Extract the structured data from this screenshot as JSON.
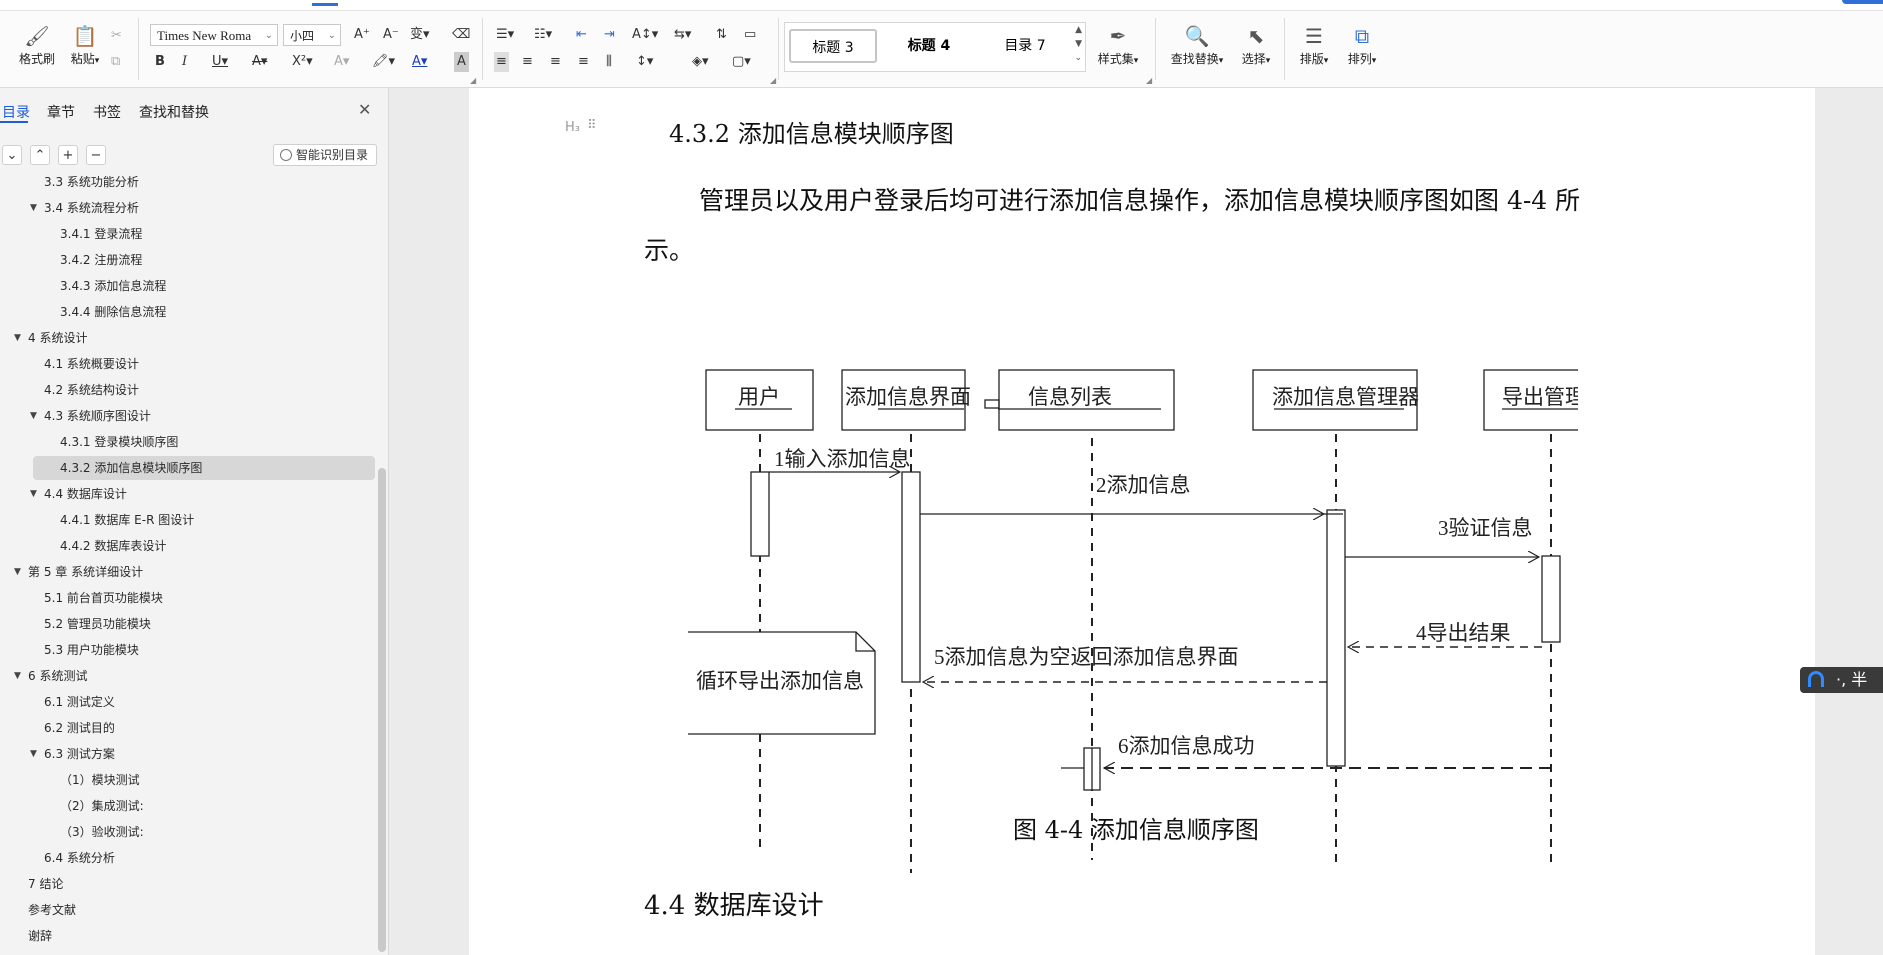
{
  "ribbon": {
    "format_painter": "格式刷",
    "paste": "粘贴",
    "font_name": "Times New Roma",
    "font_size": "小四",
    "style_gallery": [
      "标题 3",
      "标题 4",
      "目录 7"
    ],
    "style_set": "样式集",
    "find_replace": "查找替换",
    "select": "选择",
    "layout": "排版",
    "arrange": "排列"
  },
  "nav": {
    "tabs": [
      "目录",
      "章节",
      "书签",
      "查找和替换"
    ],
    "ai_toc": "智能识别目录",
    "toc": [
      {
        "label": "3.3 系统功能分析",
        "level": 2
      },
      {
        "label": "3.4 系统流程分析",
        "level": 2,
        "expanded": true
      },
      {
        "label": "3.4.1 登录流程",
        "level": 3
      },
      {
        "label": "3.4.2 注册流程",
        "level": 3
      },
      {
        "label": "3.4.3 添加信息流程",
        "level": 3
      },
      {
        "label": "3.4.4 删除信息流程",
        "level": 3
      },
      {
        "label": "4 系统设计",
        "level": 1,
        "expanded": true
      },
      {
        "label": "4.1 系统概要设计",
        "level": 2
      },
      {
        "label": "4.2 系统结构设计",
        "level": 2
      },
      {
        "label": "4.3 系统顺序图设计",
        "level": 2,
        "expanded": true
      },
      {
        "label": "4.3.1 登录模块顺序图",
        "level": 3
      },
      {
        "label": "4.3.2 添加信息模块顺序图",
        "level": 3,
        "selected": true
      },
      {
        "label": "4.4 数据库设计",
        "level": 2,
        "expanded": true
      },
      {
        "label": "4.4.1 数据库 E-R 图设计",
        "level": 3
      },
      {
        "label": "4.4.2 数据库表设计",
        "level": 3
      },
      {
        "label": "第 5 章 系统详细设计",
        "level": 1,
        "expanded": true
      },
      {
        "label": "5.1 前台首页功能模块",
        "level": 2
      },
      {
        "label": "5.2 管理员功能模块",
        "level": 2
      },
      {
        "label": "5.3 用户功能模块",
        "level": 2
      },
      {
        "label": "6 系统测试",
        "level": 1,
        "expanded": true
      },
      {
        "label": "6.1 测试定义",
        "level": 2
      },
      {
        "label": "6.2 测试目的",
        "level": 2
      },
      {
        "label": "6.3 测试方案",
        "level": 2,
        "expanded": true
      },
      {
        "label": "（1）模块测试",
        "level": 3
      },
      {
        "label": "（2）集成测试:",
        "level": 3
      },
      {
        "label": "（3）验收测试:",
        "level": 3
      },
      {
        "label": "6.4 系统分析",
        "level": 2
      },
      {
        "label": "7 结论",
        "level": 1
      },
      {
        "label": "参考文献",
        "level": 1
      },
      {
        "label": "谢辞",
        "level": 1
      }
    ]
  },
  "document": {
    "heading_mark": "H₃",
    "section_title": "4.3.2 添加信息模块顺序图",
    "paragraph_line1": "管理员以及用户登录后均可进行添加信息操作，添加信息模块顺序图如图 4-4 所",
    "paragraph_line2": "示。",
    "figure_caption": "图 4-4  添加信息顺序图",
    "next_heading": "4.4 数据库设计"
  },
  "diagram": {
    "participants": [
      "用户",
      "添加信息界面",
      "信息列表",
      "添加信息管理器",
      "导出管理器"
    ],
    "messages": [
      "1输入添加信息",
      "2添加信息",
      "3验证信息",
      "4导出结果",
      "5添加信息为空返回添加信息界面",
      "6添加信息成功"
    ],
    "note": "循环导出添加信息"
  },
  "ime": {
    "label": "·, 半"
  }
}
